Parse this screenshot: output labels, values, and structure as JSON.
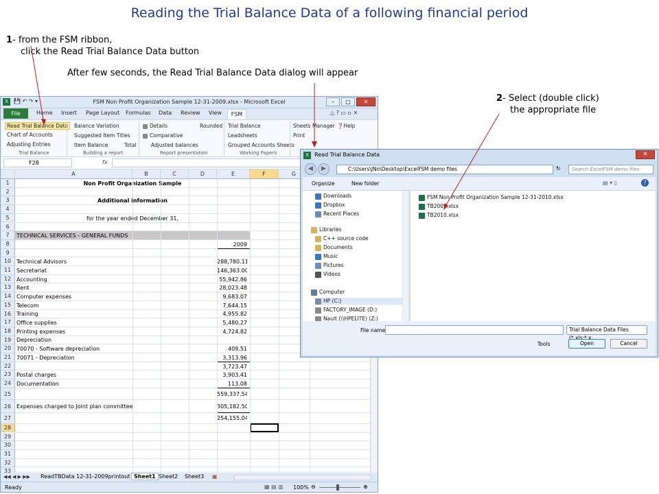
{
  "title": "Reading the Trial Balance Data of a following financial period",
  "step1": {
    "num": "1",
    "line1": "- from the FSM ribbon,",
    "line2": "click  the Read Trial  Balance  Data button"
  },
  "step_mid": "After few seconds, the Read Trial  Balance  Data dialog will  appear",
  "step2": {
    "num": "2",
    "line1": "- Select (double click)",
    "line2": "the appropriate file"
  },
  "excel": {
    "window_title": "FSM Non Profit Organization Sample 12-31-2009.xlsx  -  Microsoft Excel",
    "tabs": [
      "File",
      "Home",
      "Insert",
      "Page Layout",
      "Formulas",
      "Data",
      "Review",
      "View",
      "FSM"
    ],
    "ribbon": {
      "trial_balance": {
        "items": [
          "Read Trial Balance Data",
          "Chart of Accounts",
          "Adjusting Entries"
        ],
        "label": "Trial Balance"
      },
      "building": {
        "items": [
          "Balance Variation",
          "Suggested Item Titles",
          "Item Balance",
          "Total"
        ],
        "label": "Building a report"
      },
      "presentation": {
        "items": [
          "Details",
          "Comparative",
          "Adjusted balances",
          "Rounded"
        ],
        "label": "Report presentation"
      },
      "working": {
        "items": [
          "Trial Balance",
          "Leadsheets",
          "Grouped Accounts Sheets"
        ],
        "label": "Working Papers"
      },
      "other": {
        "items": [
          "Sheets Manager",
          "Print",
          "Help"
        ]
      }
    },
    "name_box": "F28",
    "fx": "fx",
    "columns": [
      "A",
      "B",
      "C",
      "D",
      "E",
      "F",
      "G"
    ],
    "rows": [
      {
        "n": "1",
        "a": "Non Profit Organization Sample",
        "e": ""
      },
      {
        "n": "2",
        "a": "",
        "e": ""
      },
      {
        "n": "3",
        "a": "Additional information",
        "e": ""
      },
      {
        "n": "4",
        "a": "",
        "e": ""
      },
      {
        "n": "5",
        "a": "for the year ended December 31,",
        "e": ""
      },
      {
        "n": "6",
        "a": "",
        "e": ""
      },
      {
        "n": "7",
        "a": "TECHNICAL SERVICES - GENERAL FUNDS",
        "e": ""
      },
      {
        "n": "8",
        "a": "",
        "e": "2009"
      },
      {
        "n": "9",
        "a": "",
        "e": ""
      },
      {
        "n": "10",
        "a": "Technical Advisors",
        "e": "288,780.11"
      },
      {
        "n": "11",
        "a": "Secretariat",
        "e": "146,363.00"
      },
      {
        "n": "12",
        "a": "Accounting",
        "e": "55,942.86"
      },
      {
        "n": "13",
        "a": "Rent",
        "e": "28,023.48"
      },
      {
        "n": "14",
        "a": "Computer expenses",
        "e": "9,683.07"
      },
      {
        "n": "15",
        "a": "Telecom",
        "e": "7,644.15"
      },
      {
        "n": "16",
        "a": "Training",
        "e": "4,955.82"
      },
      {
        "n": "17",
        "a": "Office supplies",
        "e": "5,480.27"
      },
      {
        "n": "18",
        "a": "Printing expenses",
        "e": "4,724.82"
      },
      {
        "n": "19",
        "a": "Depreciation",
        "e": ""
      },
      {
        "n": "20",
        "a": "   70070 - Software depreciation",
        "e": "409.51"
      },
      {
        "n": "21",
        "a": "   70071 - Depreciation",
        "e": "3,313.96"
      },
      {
        "n": "22",
        "a": "",
        "e": "3,723.47"
      },
      {
        "n": "23",
        "a": "Postal charges",
        "e": "3,903.41"
      },
      {
        "n": "24",
        "a": "Documentation",
        "e": "113.08"
      },
      {
        "n": "25",
        "a": "",
        "e": "559,337.54"
      },
      {
        "n": "26",
        "a": "Expenses charged to Joint plan committee",
        "e": "305,182.50"
      },
      {
        "n": "27",
        "a": "",
        "e": "254,155.04"
      },
      {
        "n": "28",
        "a": "",
        "e": ""
      },
      {
        "n": "29",
        "a": "",
        "e": ""
      },
      {
        "n": "30",
        "a": "",
        "e": ""
      },
      {
        "n": "31",
        "a": "",
        "e": ""
      },
      {
        "n": "32",
        "a": "",
        "e": ""
      },
      {
        "n": "33",
        "a": "",
        "e": ""
      }
    ],
    "sheet_tabs": [
      "ReadTBData 12-31-2009printout",
      "Sheet1",
      "Sheet2",
      "Sheet3"
    ],
    "status_left": "Ready",
    "zoom": "100%"
  },
  "dialog": {
    "title": "Read Trial Balance Data",
    "address": "C:\\Users\\JNo\\Desktop\\ExcelFSM demo files",
    "search_placeholder": "Search ExcelFSM demo files",
    "organize": "Organize",
    "new_folder": "New folder",
    "nav": [
      "Downloads",
      "Dropbox",
      "Recent Places",
      "Libraries",
      "C++ source code",
      "Documents",
      "Music",
      "Pictures",
      "Videos",
      "Computer",
      "HP (C:)",
      "FACTORY_IMAGE (D:)",
      "Nault (\\\\HPELITE) (Z:)"
    ],
    "files": [
      "FSM Non Profit Organization Sample 12-31-2010.xlsx",
      "TB2009.xlsx",
      "TB2010.xlsx"
    ],
    "file_name_label": "File name:",
    "file_type": "Trial Balance Data Files (*.xls;*.x",
    "tools": "Tools",
    "open": "Open",
    "cancel": "Cancel"
  }
}
